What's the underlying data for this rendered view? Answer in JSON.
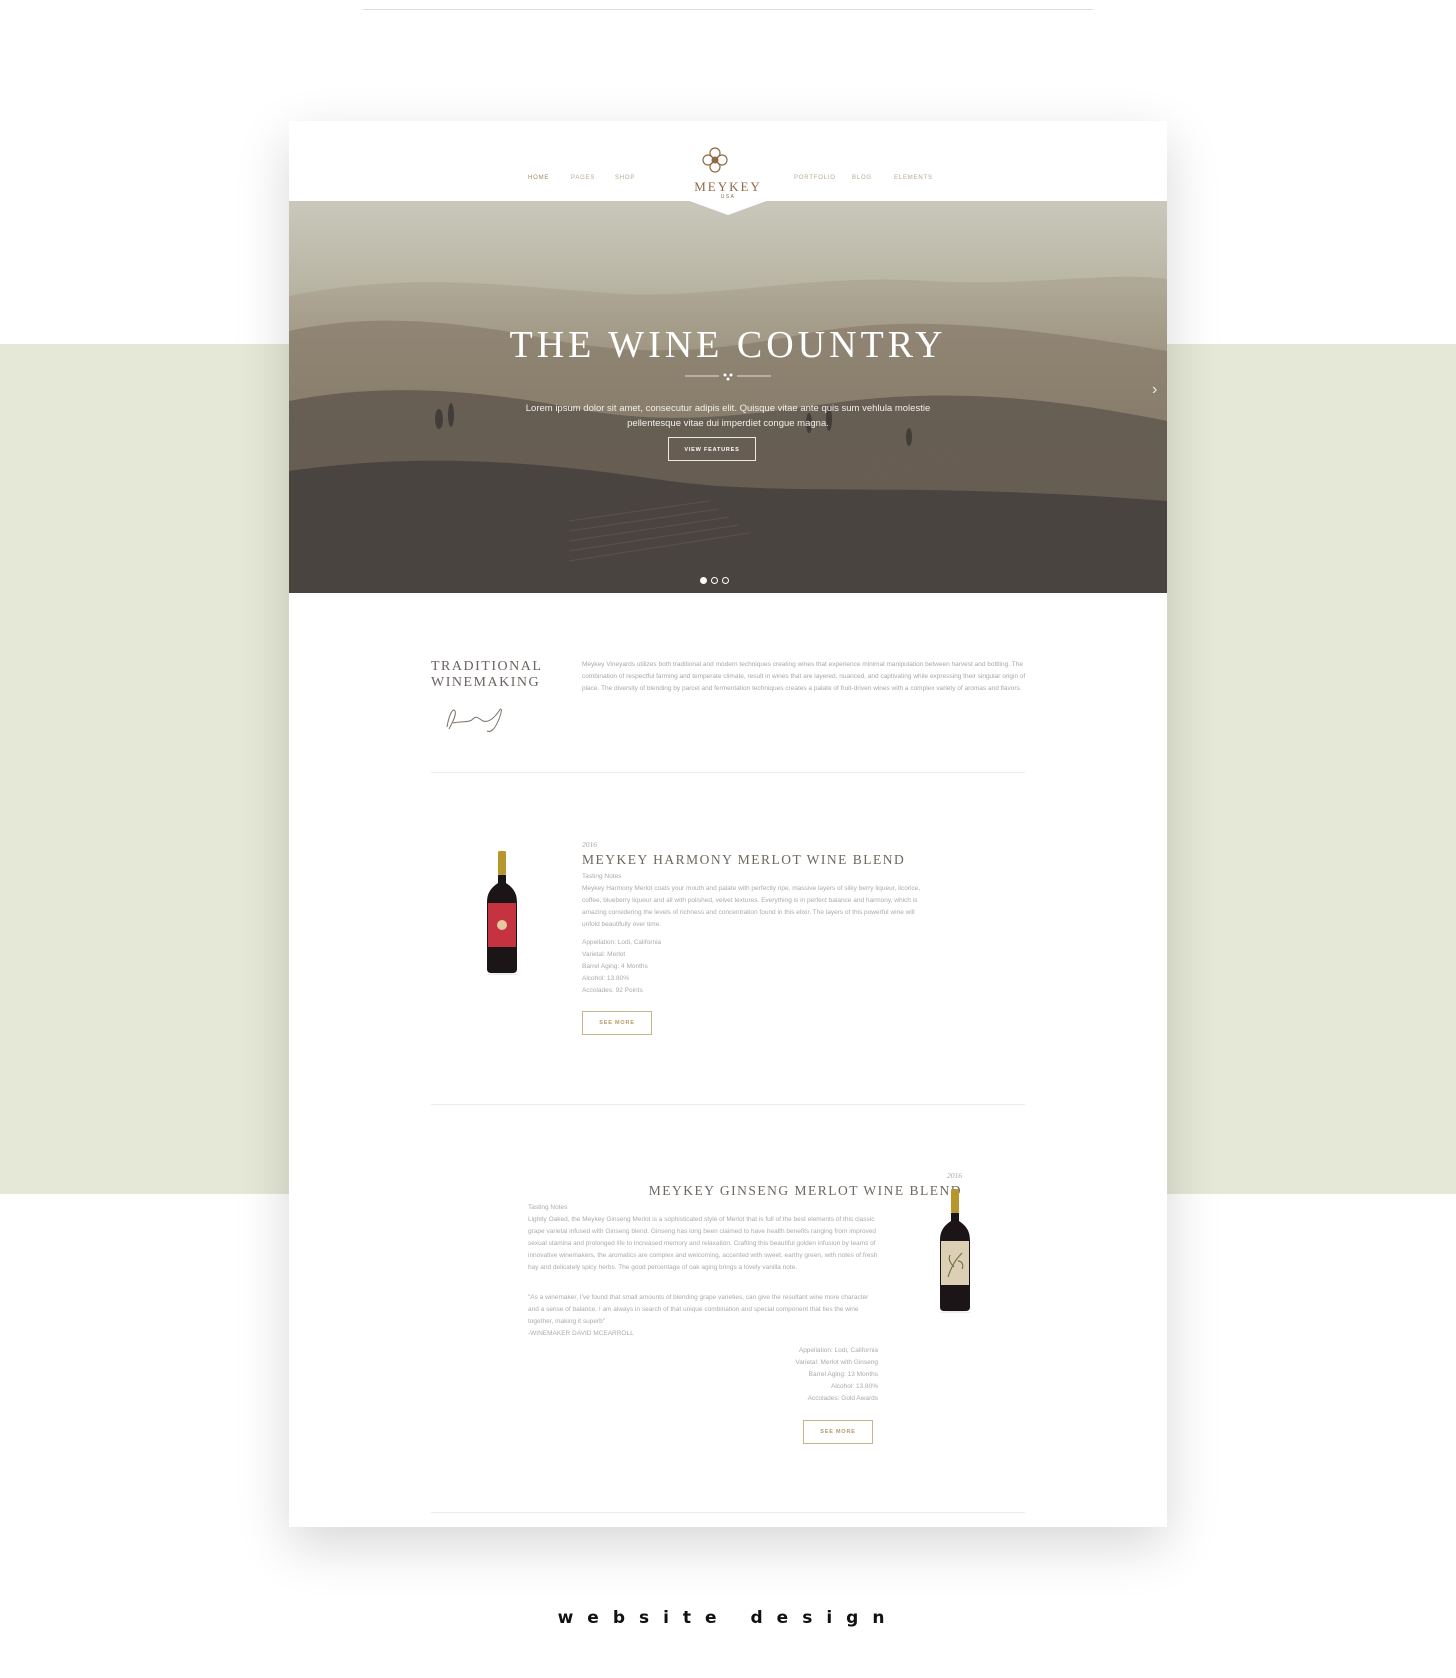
{
  "nav": {
    "left": [
      "HOME",
      "PAGES",
      "SHOP"
    ],
    "right": [
      "PORTFOLIO",
      "BLOG",
      "ELEMENTS"
    ]
  },
  "logo": {
    "name": "MEYKEY",
    "sub": "USA"
  },
  "hero": {
    "title": "THE WINE COUNTRY",
    "text": "Lorem ipsum dolor sit amet, consecutur adipis elit. Quisque vitae ante quis sum vehlula molestie pellentesque vitae dui imperdiet congue magna.",
    "button": "VIEW FEATURES",
    "next_arrow": "›",
    "active_slide": 1,
    "slide_count": 3
  },
  "intro": {
    "heading": "TRADITIONAL WINEMAKING",
    "body": "Meykey Vineyards utilizes both traditional and modern techniques creating wines that experience minimal manipulation between harvest and bottling. The combination of respectful farming and temperate climate, result in wines that are layered, nuanced, and captivating while expressing their singular origin of place. The diversity of blending by parcel and fermentation techniques creates a palate of fruit-driven wines with a complex variety of aromas and flavors."
  },
  "products": [
    {
      "year": "2016",
      "title": "MEYKEY HARMONY MERLOT WINE BLEND",
      "notes_label": "Tasting Notes",
      "notes": "Meykey Harmony Merlot coats your mouth and palate with perfectly ripe, massive layers of silky berry liqueur, licorice, coffee, blueberry liqueur and all with polished, velvet textures. Everything is in perfect balance and harmony, which is amazing considering the levels of richness and concentration found in this elixir. The layers of this powerful wine will unfold beautifully over time.",
      "specs": [
        "Appellation: Lodi, California",
        "Varietal: Merlot",
        "Barrel Aging: 4 Months",
        "Alcohol: 13.80%",
        "Accolades: 92 Points"
      ],
      "button": "SEE MORE",
      "label_color": "#c4333f"
    },
    {
      "year": "2016",
      "title": "MEYKEY GINSENG MERLOT WINE BLEND",
      "notes_label": "Tasting Notes",
      "notes": "Lightly Oaked, the Meykey Ginseng Merlot is a sophisticated style of Merlot that is full of the best elements of this classic grape varietal infused with Ginseng blend. Ginseng has long been claimed to have health benefits ranging from improved sexual stamina and prolonged life to increased memory and relaxation. Crafting this beautiful golden infusion by teams of innovative winemakers, the aromatics are complex and welcoming, accented with sweet, earthy green, with notes of fresh hay and delicately spicy herbs. The good percentage of oak aging brings a lovely vanilla note.",
      "quote": "\"As a winemaker, I've found that small amounts of blending grape varieties, can give the resultant wine more character and a sense of balance. I am always in search of that unique combination and special component that ties the wine together, making it superb\"",
      "quote_author": "-WINEMAKER DAVID MCEARROLL",
      "specs": [
        "Appellation: Lodi, California",
        "Varietal: Merlot with Ginseng",
        "Barrel Aging: 13 Months",
        "Alcohol: 13.80%",
        "Accolades: Gold Awards"
      ],
      "button": "SEE MORE",
      "label_color": "#ddcfb6"
    }
  ],
  "caption": "website design",
  "colors": {
    "band": "#e5e8d6",
    "accent": "#b39a6c"
  }
}
